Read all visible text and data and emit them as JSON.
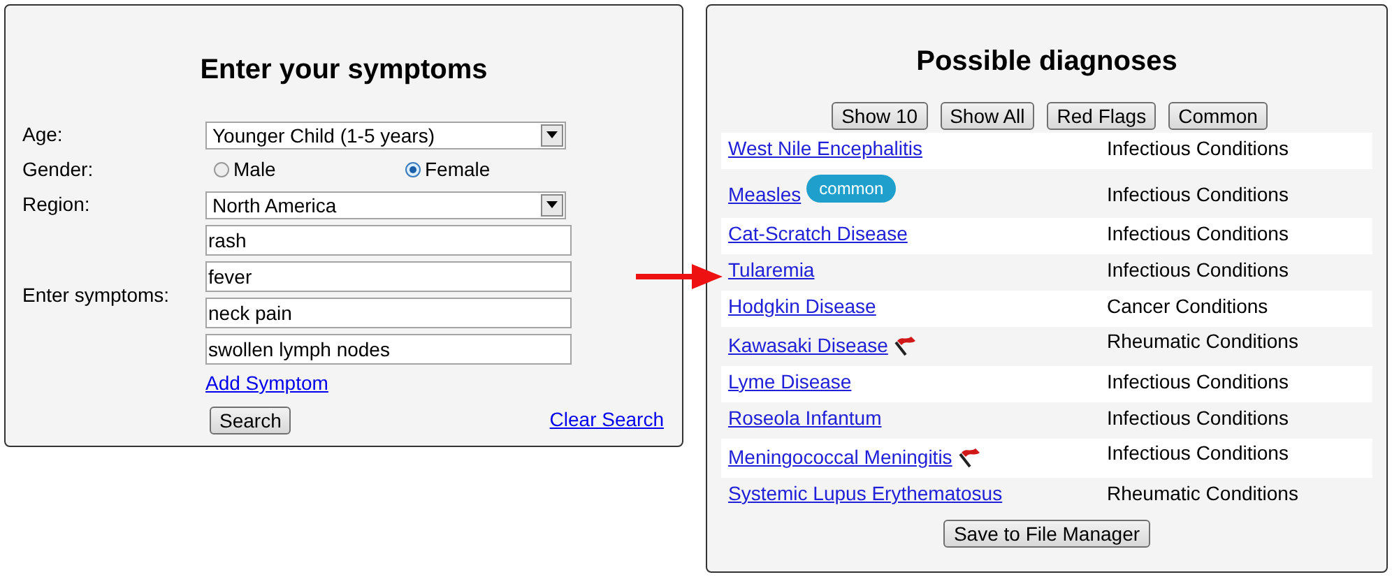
{
  "symptom_form": {
    "title": "Enter your symptoms",
    "age": {
      "label": "Age:",
      "value": "Younger Child (1-5 years)"
    },
    "gender": {
      "label": "Gender:",
      "options": [
        {
          "label": "Male",
          "selected": false
        },
        {
          "label": "Female",
          "selected": true
        }
      ]
    },
    "region": {
      "label": "Region:",
      "value": "North America"
    },
    "symptoms": {
      "label": "Enter symptoms:",
      "values": [
        "rash",
        "fever",
        "neck pain",
        "swollen lymph nodes"
      ]
    },
    "add_link": "Add Symptom",
    "search_button": "Search",
    "clear_link": "Clear Search"
  },
  "diagnoses": {
    "title": "Possible diagnoses",
    "filters": [
      "Show 10",
      "Show All",
      "Red Flags",
      "Common"
    ],
    "rows": [
      {
        "name": "West Nile Encephalitis",
        "category": "Infectious Conditions",
        "red_flag": false
      },
      {
        "name": "Measles",
        "badge": "common",
        "category": "Infectious Conditions",
        "red_flag": false
      },
      {
        "name": "Cat-Scratch Disease",
        "category": "Infectious Conditions",
        "red_flag": false
      },
      {
        "name": "Tularemia",
        "category": "Infectious Conditions",
        "red_flag": false,
        "pointed": true
      },
      {
        "name": "Hodgkin Disease",
        "category": "Cancer Conditions",
        "red_flag": false
      },
      {
        "name": "Kawasaki Disease",
        "category": "Rheumatic Conditions",
        "red_flag": true
      },
      {
        "name": "Lyme Disease",
        "category": "Infectious Conditions",
        "red_flag": false
      },
      {
        "name": "Roseola Infantum",
        "category": "Infectious Conditions",
        "red_flag": false
      },
      {
        "name": "Meningococcal Meningitis",
        "category": "Infectious Conditions",
        "red_flag": true
      },
      {
        "name": "Systemic Lupus Erythematosus",
        "category": "Rheumatic Conditions",
        "red_flag": false
      }
    ],
    "save_button": "Save to File Manager"
  }
}
